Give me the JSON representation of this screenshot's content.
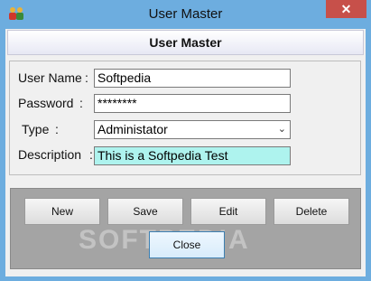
{
  "window": {
    "title": "User Master",
    "app_icon": "users-icon",
    "close_glyph": "✕"
  },
  "header": {
    "title": "User Master"
  },
  "form": {
    "username": {
      "label": "User Name",
      "colon": ":",
      "value": "Softpedia"
    },
    "password": {
      "label": "Password",
      "colon": ":",
      "value": "********"
    },
    "type": {
      "label": "Type",
      "colon": ":",
      "value": "Administator",
      "chevron": "⌄"
    },
    "description": {
      "label": "Description",
      "colon": ":",
      "value": "This is a Softpedia Test"
    }
  },
  "buttons": {
    "new": "New",
    "save": "Save",
    "edit": "Edit",
    "delete": "Delete",
    "close": "Close"
  },
  "watermark": "SOFTPEDIA",
  "colors": {
    "titlebar": "#6daddf",
    "close_button": "#c7504a",
    "description_bg": "#aef3ee",
    "button_panel": "#a4a4a4"
  }
}
